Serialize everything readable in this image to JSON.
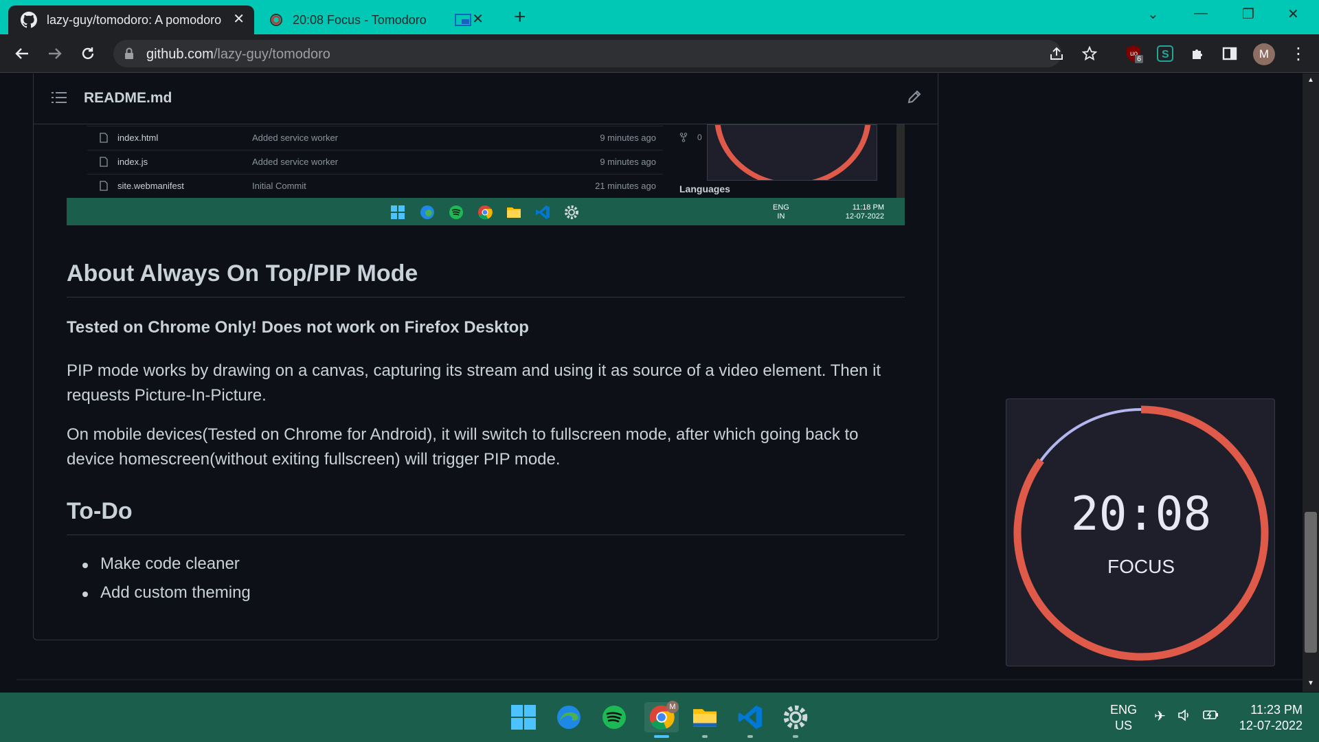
{
  "browser": {
    "tabs": [
      {
        "title": "lazy-guy/tomodoro: A pomodoro",
        "icon": "github-icon",
        "active": true
      },
      {
        "title": "20:08 Focus - Tomodoro",
        "icon": "tomodoro-icon",
        "active": false
      }
    ],
    "url_host": "github.com",
    "url_path": "/lazy-guy/tomodoro",
    "ublock_badge": "6",
    "profile_initial": "M"
  },
  "readme": {
    "file_name": "README.md",
    "embedded_screenshot": {
      "files": [
        {
          "name": "index.html",
          "message": "Added service worker",
          "time": "9 minutes ago"
        },
        {
          "name": "index.js",
          "message": "Added service worker",
          "time": "9 minutes ago"
        },
        {
          "name": "site.webmanifest",
          "message": "Initial Commit",
          "time": "21 minutes ago"
        }
      ],
      "fork_count": "0",
      "languages_label": "Languages",
      "taskbar_lang_line1": "ENG",
      "taskbar_lang_line2": "IN",
      "taskbar_time": "11:18 PM",
      "taskbar_date": "12-07-2022"
    },
    "about_heading": "About Always On Top/PIP Mode",
    "warning": "Tested on Chrome Only! Does not work on Firefox Desktop",
    "para1": "PIP mode works by drawing on a canvas, capturing its stream and using it as source of a video element. Then it requests Picture-In-Picture.",
    "para2": "On mobile devices(Tested on Chrome for Android), it will switch to fullscreen mode, after which going back to device homescreen(without exiting fullscreen) will trigger PIP mode.",
    "todo_heading": "To-Do",
    "todo_items": [
      "Make code cleaner",
      "Add custom theming"
    ]
  },
  "pip": {
    "time": "20:08",
    "mode": "FOCUS",
    "progress": 0.85,
    "colors": {
      "progress": "#e05a4a",
      "remaining": "#b4b6f0",
      "background": "#1e1f2b"
    }
  },
  "taskbar": {
    "lang_line1": "ENG",
    "lang_line2": "US",
    "time": "11:23 PM",
    "date": "12-07-2022",
    "chrome_badge": "M"
  }
}
